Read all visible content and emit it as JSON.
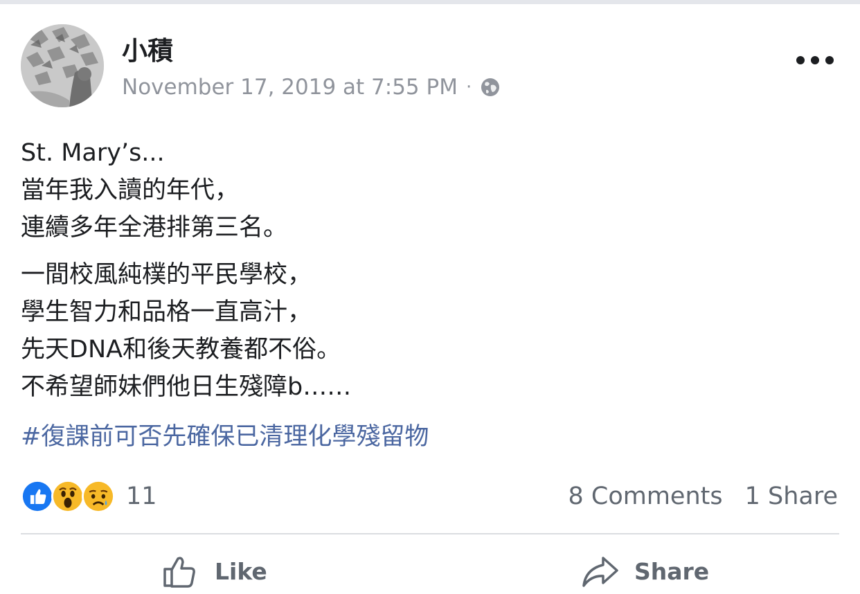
{
  "post": {
    "author": "小積",
    "timestamp": "November 17, 2019 at 7:55 PM",
    "separator": "·",
    "privacy_icon": "globe-icon",
    "paragraphs": [
      [
        "St. Mary’s...",
        "當年我入讀的年代，",
        "連續多年全港排第三名。"
      ],
      [
        "一間校風純樸的平民學校，",
        "學生智力和品格一直高汁，",
        "先天DNA和後天教養都不俗。",
        "不希望師妹們他日生殘障b……"
      ]
    ],
    "hashtag": "#復課前可否先確保已清理化學殘留物"
  },
  "engagement": {
    "reaction_icons": [
      "like-icon",
      "wow-icon",
      "sad-icon"
    ],
    "reaction_count": "11",
    "comments": "8 Comments",
    "shares": "1 Share"
  },
  "actions": {
    "like_label": "Like",
    "share_label": "Share"
  },
  "colors": {
    "text": "#1c1e21",
    "secondary": "#606770",
    "meta": "#90949c",
    "hashtag": "#4b67a1",
    "like_blue": "#1877f2",
    "emoji_yellow": "#f7b928"
  }
}
